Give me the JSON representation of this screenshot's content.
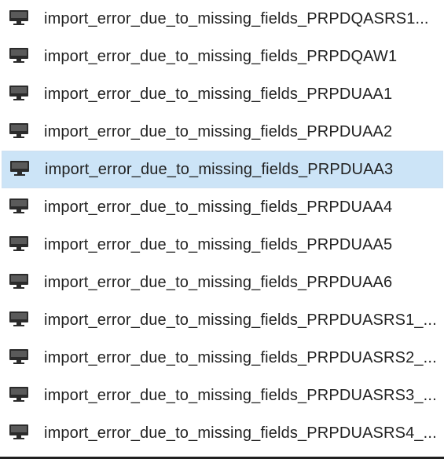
{
  "file_list": {
    "items": [
      {
        "label": "import_error_due_to_missing_fields_PRPDQASRS1...",
        "icon": "computer-icon",
        "selected": false
      },
      {
        "label": "import_error_due_to_missing_fields_PRPDQAW1",
        "icon": "computer-icon",
        "selected": false
      },
      {
        "label": "import_error_due_to_missing_fields_PRPDUAA1",
        "icon": "computer-icon",
        "selected": false
      },
      {
        "label": "import_error_due_to_missing_fields_PRPDUAA2",
        "icon": "computer-icon",
        "selected": false
      },
      {
        "label": "import_error_due_to_missing_fields_PRPDUAA3",
        "icon": "computer-icon",
        "selected": true
      },
      {
        "label": "import_error_due_to_missing_fields_PRPDUAA4",
        "icon": "computer-icon",
        "selected": false
      },
      {
        "label": "import_error_due_to_missing_fields_PRPDUAA5",
        "icon": "computer-icon",
        "selected": false
      },
      {
        "label": "import_error_due_to_missing_fields_PRPDUAA6",
        "icon": "computer-icon",
        "selected": false
      },
      {
        "label": "import_error_due_to_missing_fields_PRPDUASRS1_...",
        "icon": "computer-icon",
        "selected": false
      },
      {
        "label": "import_error_due_to_missing_fields_PRPDUASRS2_...",
        "icon": "computer-icon",
        "selected": false
      },
      {
        "label": "import_error_due_to_missing_fields_PRPDUASRS3_...",
        "icon": "computer-icon",
        "selected": false
      },
      {
        "label": "import_error_due_to_missing_fields_PRPDUASRS4_...",
        "icon": "computer-icon",
        "selected": false
      }
    ]
  },
  "colors": {
    "selection_background": "#cce4f7",
    "text": "#222222",
    "icon": "#2b2b2b"
  }
}
